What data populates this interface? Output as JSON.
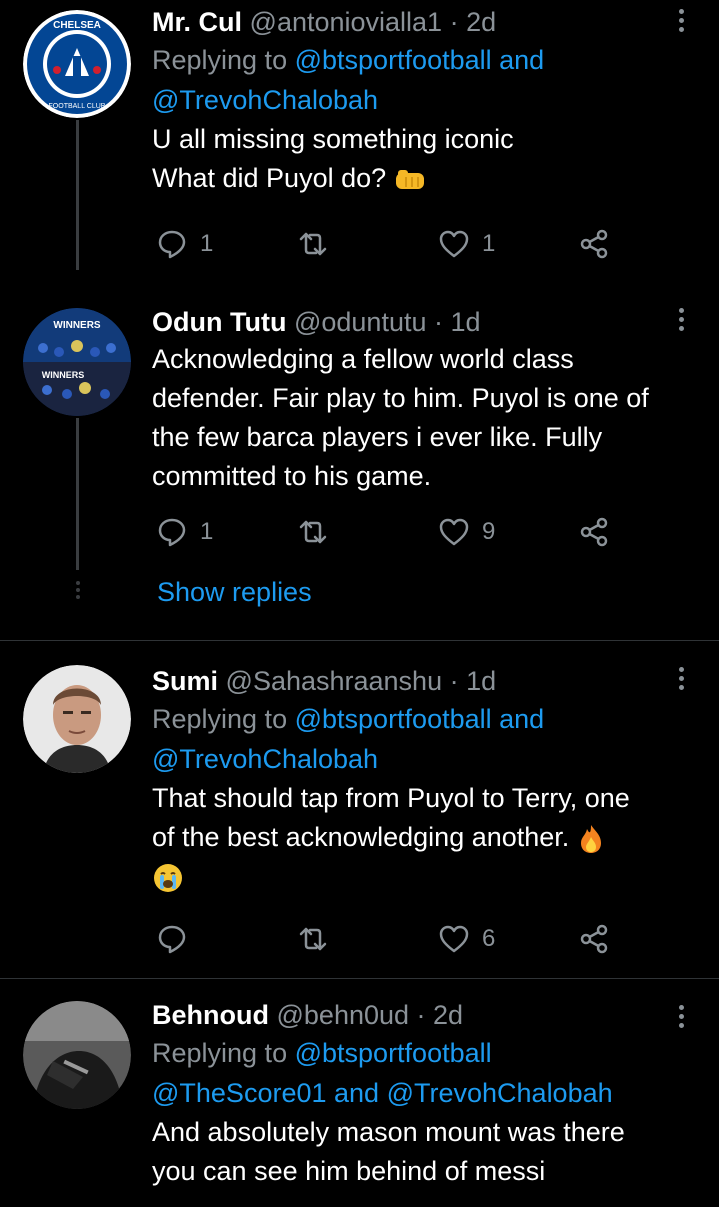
{
  "tweets": [
    {
      "name": "Mr. Cul",
      "handle": "@antoniovialla1",
      "time": "· 2d",
      "reply_prefix": "Replying to",
      "reply_line1": "@btsportfootball and",
      "reply_line2": "@TrevohChalobah",
      "text_lines": [
        "U all missing something iconic",
        "What did Puyol do?"
      ],
      "replies": "1",
      "retweets": "",
      "likes": "1",
      "avatar": "chelsea-crest"
    },
    {
      "name": "Odun Tutu",
      "handle": "@oduntutu",
      "time": "· 1d",
      "text_lines": [
        "Acknowledging a fellow world class",
        "defender. Fair play to him. Puyol is one of",
        "the few barca players i ever like. Fully",
        "committed to his game."
      ],
      "replies": "1",
      "retweets": "",
      "likes": "9",
      "avatar_text_1": "WINNERS",
      "avatar_text_2": "WINNERS"
    },
    {
      "name": "Sumi",
      "handle": "@Sahashraanshu",
      "time": "· 1d",
      "reply_prefix": "Replying to",
      "reply_line1": "@btsportfootball and",
      "reply_line2": "@TrevohChalobah",
      "text_lines": [
        "That should tap from Puyol to Terry, one",
        "of the best acknowledging another."
      ],
      "replies": "",
      "retweets": "",
      "likes": "6",
      "avatar": "man-portrait"
    },
    {
      "name": "Behnoud",
      "handle": "@behn0ud",
      "time": "· 2d",
      "reply_prefix": "Replying to",
      "reply_line1": "@btsportfootball",
      "reply_line2_a": "@TheScore01",
      "reply_line2_and": "and",
      "reply_line2_b": "@TrevohChalobah",
      "text_lines": [
        "And absolutely mason mount was there",
        "you can see him behind of messi"
      ],
      "avatar": "dark-photo"
    }
  ],
  "show_replies": "Show replies",
  "colors": {
    "link": "#1d9bf0",
    "muted": "#8b9298",
    "background": "#000000",
    "divider": "#2f3336"
  }
}
